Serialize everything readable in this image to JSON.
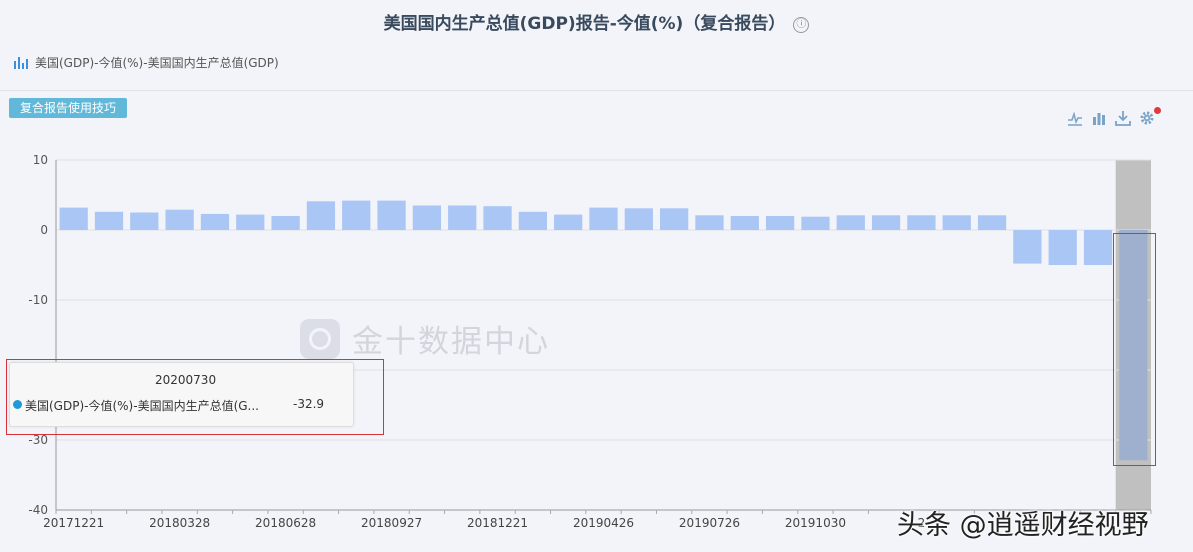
{
  "header": {
    "title": "美国国内生产总值(GDP)报告-今值(%)（复合报告）",
    "info_icon": "ⓘ"
  },
  "legend": {
    "label": "美国(GDP)-今值(%)-美国国内生产总值(GDP)"
  },
  "toolbar": {
    "tips_label": "复合报告使用技巧",
    "line_icon": "line-chart-icon",
    "bar_icon": "bar-chart-icon",
    "download_icon": "download-icon",
    "settings_icon": "gear-icon"
  },
  "watermark": {
    "text": "金十数据中心"
  },
  "credit": {
    "text": "头条 @逍遥财经视野"
  },
  "tooltip": {
    "date": "20200730",
    "series_name": "美国(GDP)-今值(%)-美国国内生产总值(G...",
    "value": "-32.9"
  },
  "colors": {
    "bar": "#a9c6f5",
    "highlight_bar": "#9fb0cf",
    "highlight_band": "#c0c0c0",
    "marker": "#1e9bd7",
    "alert": "#d9303a"
  },
  "chart_data": {
    "type": "bar",
    "series": [
      {
        "name": "美国(GDP)-今值(%)-美国国内生产总值(GDP)",
        "values": [
          3.2,
          2.6,
          2.5,
          2.9,
          2.3,
          2.2,
          2.0,
          4.1,
          4.2,
          4.2,
          3.5,
          3.5,
          3.4,
          2.6,
          2.2,
          3.2,
          3.1,
          3.1,
          2.1,
          2.0,
          2.0,
          1.9,
          2.1,
          2.1,
          2.1,
          2.1,
          2.1,
          -4.8,
          -5.0,
          -5.0,
          -32.9
        ]
      }
    ],
    "x_tick_labels": [
      "20171221",
      "20180328",
      "20180628",
      "20180927",
      "20181221",
      "20190426",
      "20190726",
      "20191030",
      "2"
    ],
    "y_ticks": [
      10,
      0,
      -10,
      -20,
      -30,
      -40
    ],
    "ylim": [
      -40,
      10
    ],
    "highlighted_index": 30,
    "grid": true
  }
}
